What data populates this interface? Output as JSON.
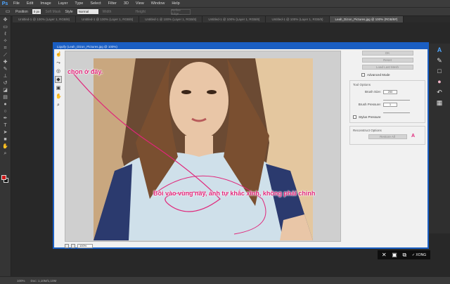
{
  "app": {
    "logo": "Ps"
  },
  "menu": [
    "File",
    "Edit",
    "Image",
    "Layer",
    "Type",
    "Select",
    "Filter",
    "3D",
    "View",
    "Window",
    "Help"
  ],
  "options_bar": {
    "position_label": "Position",
    "position_value": "0 px",
    "soft_mask": "Soft Mask",
    "style_label": "Style",
    "style_value": "Normal",
    "width_label": "Width",
    "height_label": "Height",
    "refine_button": "Refine Edge..."
  },
  "doc_tabs": [
    "Untitled-1 @ 100% (Layer 1, RGB/8)",
    "Untitled-1 @ 100% (Layer 1, RGB/8)",
    "Untitled-1 @ 100% (Layer 1, RGB/8)",
    "Untitled-1 @ 100% (Layer 1, RGB/8)",
    "Untitled-1 @ 100% (Layer 1, RGB/8)",
    "Leah_Dizon_Pictures.jpg @ 100% (RGB/8#)"
  ],
  "active_tab_index": 5,
  "liquify": {
    "title": "Liquify (Leah_Dizon_Pictures.jpg @ 100%)",
    "zoom": "100%",
    "buttons": {
      "ok": "OK",
      "reset": "Reset",
      "load_last_mesh": "Load Last Mesh"
    },
    "advanced_mode": "Advanced Mode",
    "tool_options": {
      "title": "Tool Options",
      "brush_size_label": "Brush Size:",
      "brush_size_value": "200",
      "brush_pressure_label": "Brush Pressure:",
      "brush_pressure_value": "1",
      "stylus_pressure": "Stylus Pressure"
    },
    "reconstruct_options": {
      "title": "Reconstruct Options",
      "restore_all": "Restore All"
    }
  },
  "capture_bar": {
    "done_label": "XONG"
  },
  "status_bar": {
    "zoom": "100%",
    "doc": "Doc: 1,10M/1,10M"
  },
  "annotations": {
    "pick_here": "chọn ở đây.",
    "paint_hint": "Bôi vào vùng này, ảnh tự khắc xinh, không phải chỉnh"
  },
  "colors": {
    "accent": "#1a5ec2",
    "annotation": "#e0267a",
    "foreground_swatch": "#d01818"
  }
}
